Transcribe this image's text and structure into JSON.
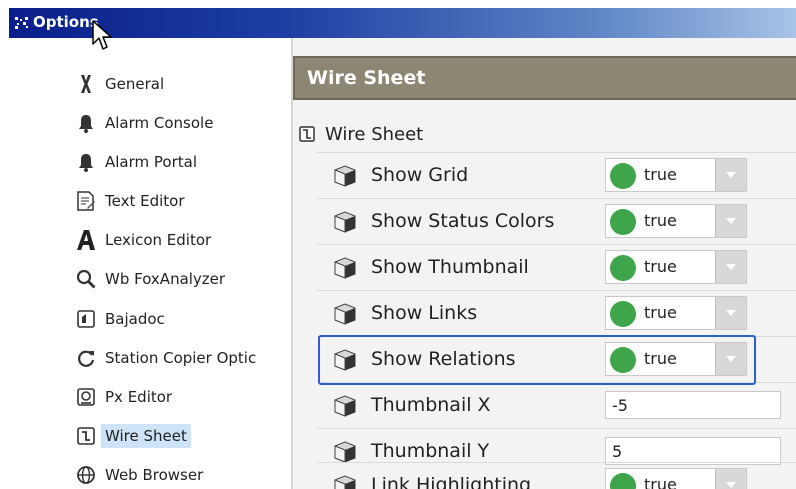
{
  "window": {
    "title": "Options"
  },
  "sidebar": {
    "items": [
      {
        "label": "General",
        "icon": "wrench-icon"
      },
      {
        "label": "Alarm Console",
        "icon": "bell-icon"
      },
      {
        "label": "Alarm Portal",
        "icon": "bell-icon"
      },
      {
        "label": "Text Editor",
        "icon": "text-document-icon"
      },
      {
        "label": "Lexicon Editor",
        "icon": "letter-a-icon"
      },
      {
        "label": "Wb FoxAnalyzer",
        "icon": "magnifier-icon"
      },
      {
        "label": "Bajadoc",
        "icon": "bajadoc-icon"
      },
      {
        "label": "Station Copier Optic",
        "icon": "refresh-icon"
      },
      {
        "label": "Px Editor",
        "icon": "px-editor-icon"
      },
      {
        "label": "Wire Sheet",
        "icon": "wire-sheet-icon",
        "selected": true
      },
      {
        "label": "Web Browser",
        "icon": "globe-icon"
      }
    ]
  },
  "panel": {
    "header": "Wire Sheet",
    "tree_root": "Wire Sheet",
    "properties": [
      {
        "label": "Show Grid",
        "type": "bool",
        "value": "true"
      },
      {
        "label": "Show Status Colors",
        "type": "bool",
        "value": "true"
      },
      {
        "label": "Show Thumbnail",
        "type": "bool",
        "value": "true"
      },
      {
        "label": "Show Links",
        "type": "bool",
        "value": "true"
      },
      {
        "label": "Show Relations",
        "type": "bool",
        "value": "true",
        "highlighted": true
      },
      {
        "label": "Thumbnail X",
        "type": "text",
        "value": "-5"
      },
      {
        "label": "Thumbnail Y",
        "type": "text",
        "value": "5"
      },
      {
        "label": "Link Highlighting",
        "type": "bool",
        "value": "true"
      }
    ]
  },
  "colors": {
    "title_bar": "#0a1e8a",
    "panel_header": "#8c8672",
    "true_indicator": "#3fa54a",
    "selection": "#cde3f7",
    "highlight_box": "#2f5fc4"
  }
}
